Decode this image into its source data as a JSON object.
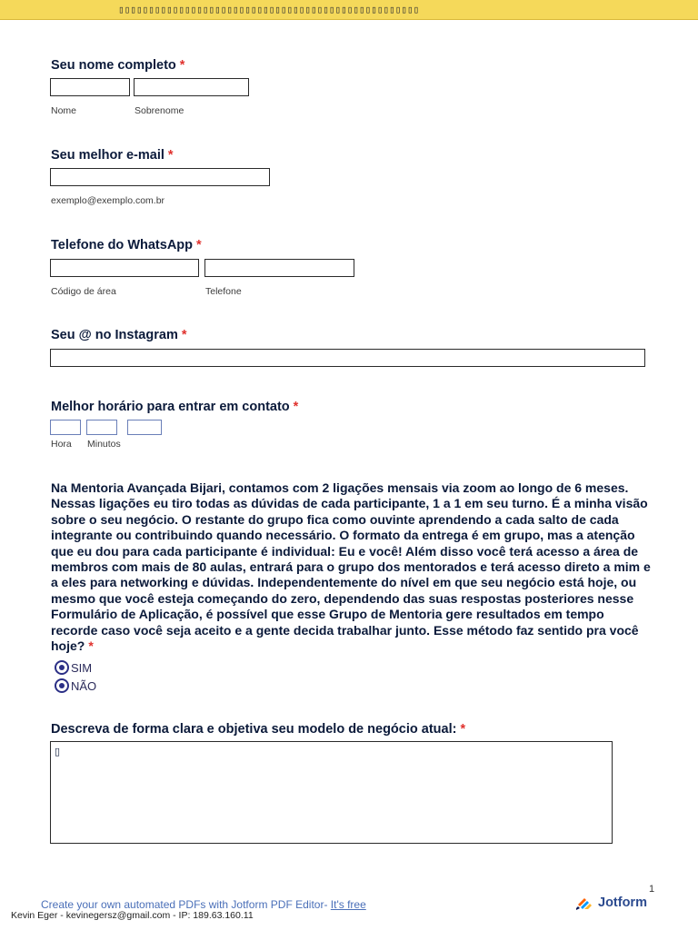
{
  "banner": {
    "text": "▯▯▯▯▯▯▯▯▯▯▯▯▯▯▯▯▯▯▯▯▯▯▯▯▯▯▯▯▯▯▯▯▯▯▯▯▯▯▯▯▯▯▯▯▯▯▯▯▯▯"
  },
  "required_mark": "*",
  "fields": {
    "name": {
      "label": "Seu nome completo",
      "first_sub": "Nome",
      "last_sub": "Sobrenome"
    },
    "email": {
      "label": "Seu melhor e-mail",
      "sub": "exemplo@exemplo.com.br"
    },
    "whatsapp": {
      "label": "Telefone do WhatsApp",
      "area_sub": "Código de área",
      "phone_sub": "Telefone"
    },
    "instagram": {
      "label": "Seu @ no Instagram"
    },
    "contact_time": {
      "label": "Melhor horário para entrar em contato",
      "hour_sub": "Hora",
      "minute_sub": "Minutos"
    },
    "mentoring": {
      "question": "Na Mentoria Avançada Bijari, contamos com 2 ligações mensais via zoom ao longo de 6 meses. Nessas ligações eu tiro todas as dúvidas de cada participante, 1 a 1 em seu turno. É a minha visão sobre o seu negócio. O restante do grupo fica como ouvinte aprendendo a cada salto de cada integrante ou contribuindo quando necessário. O formato da entrega é em grupo, mas a atenção que eu dou para cada participante é individual: Eu e você! Além disso você terá acesso a área de membros com mais de 80 aulas, entrará para o grupo dos mentorados e terá acesso direto a mim e a eles para networking e dúvidas.  Independentemente do nível em que seu negócio está hoje, ou mesmo que você esteja começando do zero, dependendo das suas respostas posteriores nesse Formulário de Aplicação, é possível que esse Grupo de Mentoria gere resultados em tempo recorde caso você seja aceito e a gente decida trabalhar junto. Esse método faz sentido pra você hoje?",
      "options": [
        "SIM",
        "NÃO"
      ]
    },
    "business": {
      "label": "Descreva de forma clara e objetiva seu modelo de negócio atual:",
      "content": "▯"
    }
  },
  "footer": {
    "page_number": "1",
    "link_prefix": "Create your own automated PDFs with Jotform PDF Editor- ",
    "link_text": "It's free",
    "user_line": "Kevin Eger - kevinegersz@gmail.com - IP: 189.63.160.11",
    "brand": "Jotform"
  },
  "colors": {
    "banner": "#f5d95a",
    "required": "#e0322e",
    "radio": "#2b2f86",
    "brand": "#2b4a8f"
  }
}
